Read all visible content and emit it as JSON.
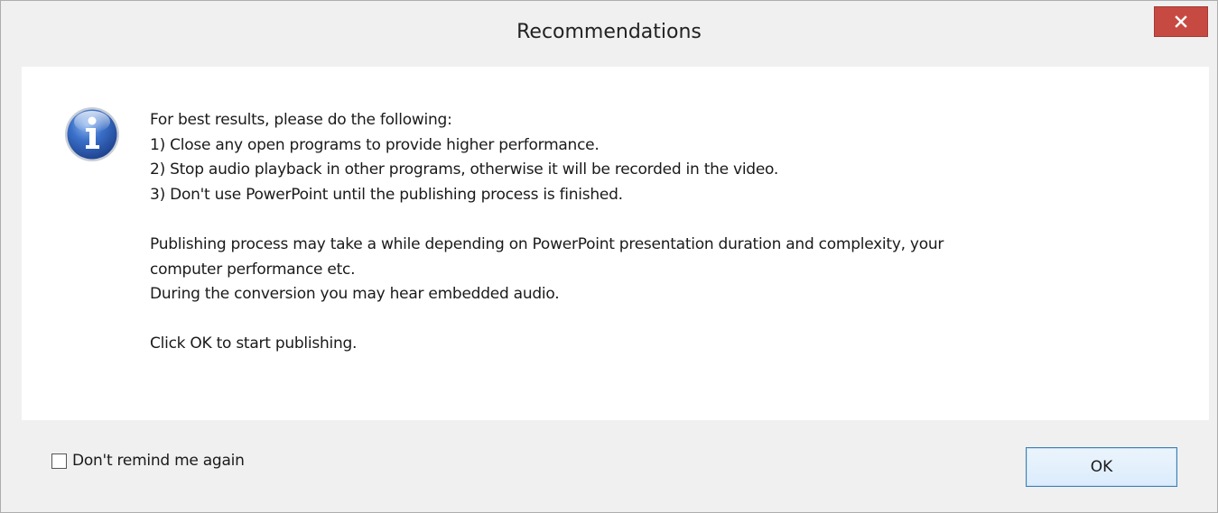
{
  "window": {
    "title": "Recommendations",
    "close_icon": "close-icon"
  },
  "content": {
    "icon": "info-icon",
    "lines": [
      "For best results, please do the following:",
      "1) Close any open programs to provide higher performance.",
      "2) Stop audio playback in other programs, otherwise it will be recorded in the video.",
      "3) Don't use PowerPoint until the publishing process is finished.",
      "Publishing process may take a while depending on PowerPoint presentation duration and complexity, your",
      "computer performance etc.",
      "During the conversion you may hear embedded audio.",
      "Click OK to start publishing."
    ]
  },
  "footer": {
    "remind_label": "Don't remind me again",
    "remind_checked": false,
    "ok_label": "OK"
  },
  "colors": {
    "close_button": "#c74a42",
    "ok_border": "#3c7fb1",
    "info_icon": "#2f5fb0"
  }
}
